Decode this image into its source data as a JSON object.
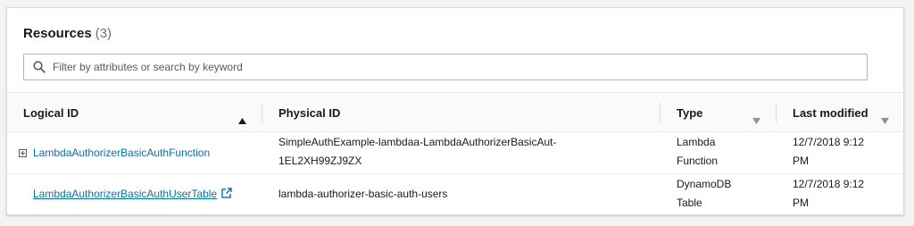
{
  "header": {
    "title": "Resources",
    "count": "(3)"
  },
  "search": {
    "placeholder": "Filter by attributes or search by keyword",
    "icon": "search-icon"
  },
  "table": {
    "columns": [
      {
        "label": "Logical ID",
        "sort": "ascending"
      },
      {
        "label": "Physical ID"
      },
      {
        "label": "Type",
        "sort": "filter"
      },
      {
        "label": "Last modified",
        "sort": "filter"
      }
    ],
    "rows": [
      {
        "logical_id": "LambdaAuthorizerBasicAuthFunction",
        "physical_id_line1": "SimpleAuthExample-lambdaa-LambdaAuthorizerBasicAut-",
        "physical_id_line2": "1EL2XH99ZJ9ZX",
        "type_line1": "Lambda",
        "type_line2": "Function",
        "modified_line1": "12/7/2018 9:12",
        "modified_line2": "PM",
        "expandable": true
      },
      {
        "logical_id": "LambdaAuthorizerBasicAuthUserTable",
        "physical_id_line1": "lambda-authorizer-basic-auth-users",
        "type_line1": "DynamoDB",
        "type_line2": "Table",
        "modified_line1": "12/7/2018 9:12",
        "modified_line2": "PM",
        "external_link": true
      }
    ]
  },
  "colors": {
    "link": "#0073bb",
    "text": "#16191f",
    "muted": "#687078",
    "border": "#d5dbdb"
  }
}
